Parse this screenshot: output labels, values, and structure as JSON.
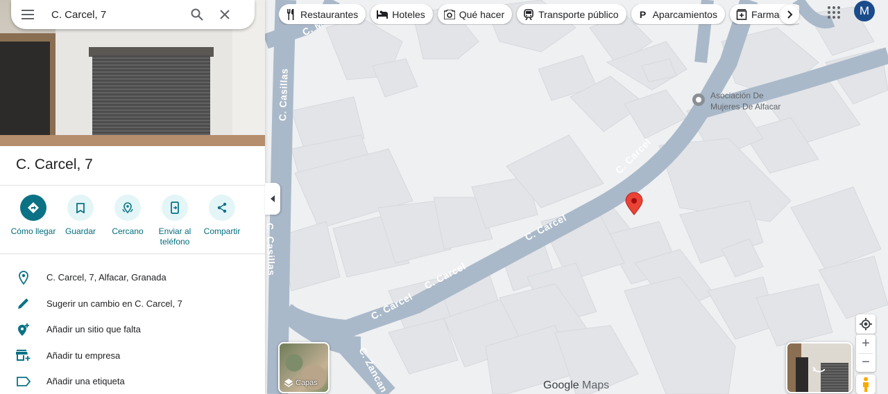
{
  "search": {
    "value": "C. Carcel, 7"
  },
  "place": {
    "title": "C. Carcel, 7",
    "actions": [
      {
        "label": "Cómo llegar"
      },
      {
        "label": "Guardar"
      },
      {
        "label": "Cercano"
      },
      {
        "label": "Enviar al teléfono"
      },
      {
        "label": "Compartir"
      }
    ],
    "rows": [
      {
        "text": "C. Carcel, 7, Alfacar, Granada"
      },
      {
        "text": "Sugerir un cambio en C. Carcel, 7"
      },
      {
        "text": "Añadir un sitio que falta"
      },
      {
        "text": "Añadir tu empresa"
      },
      {
        "text": "Añadir una etiqueta"
      }
    ]
  },
  "chips": [
    {
      "label": "Restaurantes",
      "icon": "fork-knife-icon"
    },
    {
      "label": "Hoteles",
      "icon": "bed-icon"
    },
    {
      "label": "Qué hacer",
      "icon": "camera-icon"
    },
    {
      "label": "Transporte público",
      "icon": "train-icon"
    },
    {
      "label": "Aparcamientos",
      "icon": "parking-icon"
    },
    {
      "label": "Farmacias",
      "icon": "pharmacy-icon"
    }
  ],
  "account": {
    "initial": "M",
    "color": "#1a4c8b"
  },
  "map": {
    "streets": [
      "C. Carcel",
      "C. Carcel",
      "C. Carcel",
      "C. Carcel",
      "C. Casillas",
      "C. Casillas",
      "C. Zancan",
      "C. M"
    ],
    "poi": {
      "line1": "Asociación De",
      "line2": "Mujeres De Alfacar"
    },
    "marker_color": "#ea4335",
    "road_color": "#aab9c9"
  },
  "controls": {
    "layers_label": "Capas",
    "logo_google": "Google",
    "logo_maps": "Maps",
    "zoom_in": "+",
    "zoom_out": "−"
  },
  "colors": {
    "accent": "#0b7285",
    "accent_text": "#006c7c"
  }
}
